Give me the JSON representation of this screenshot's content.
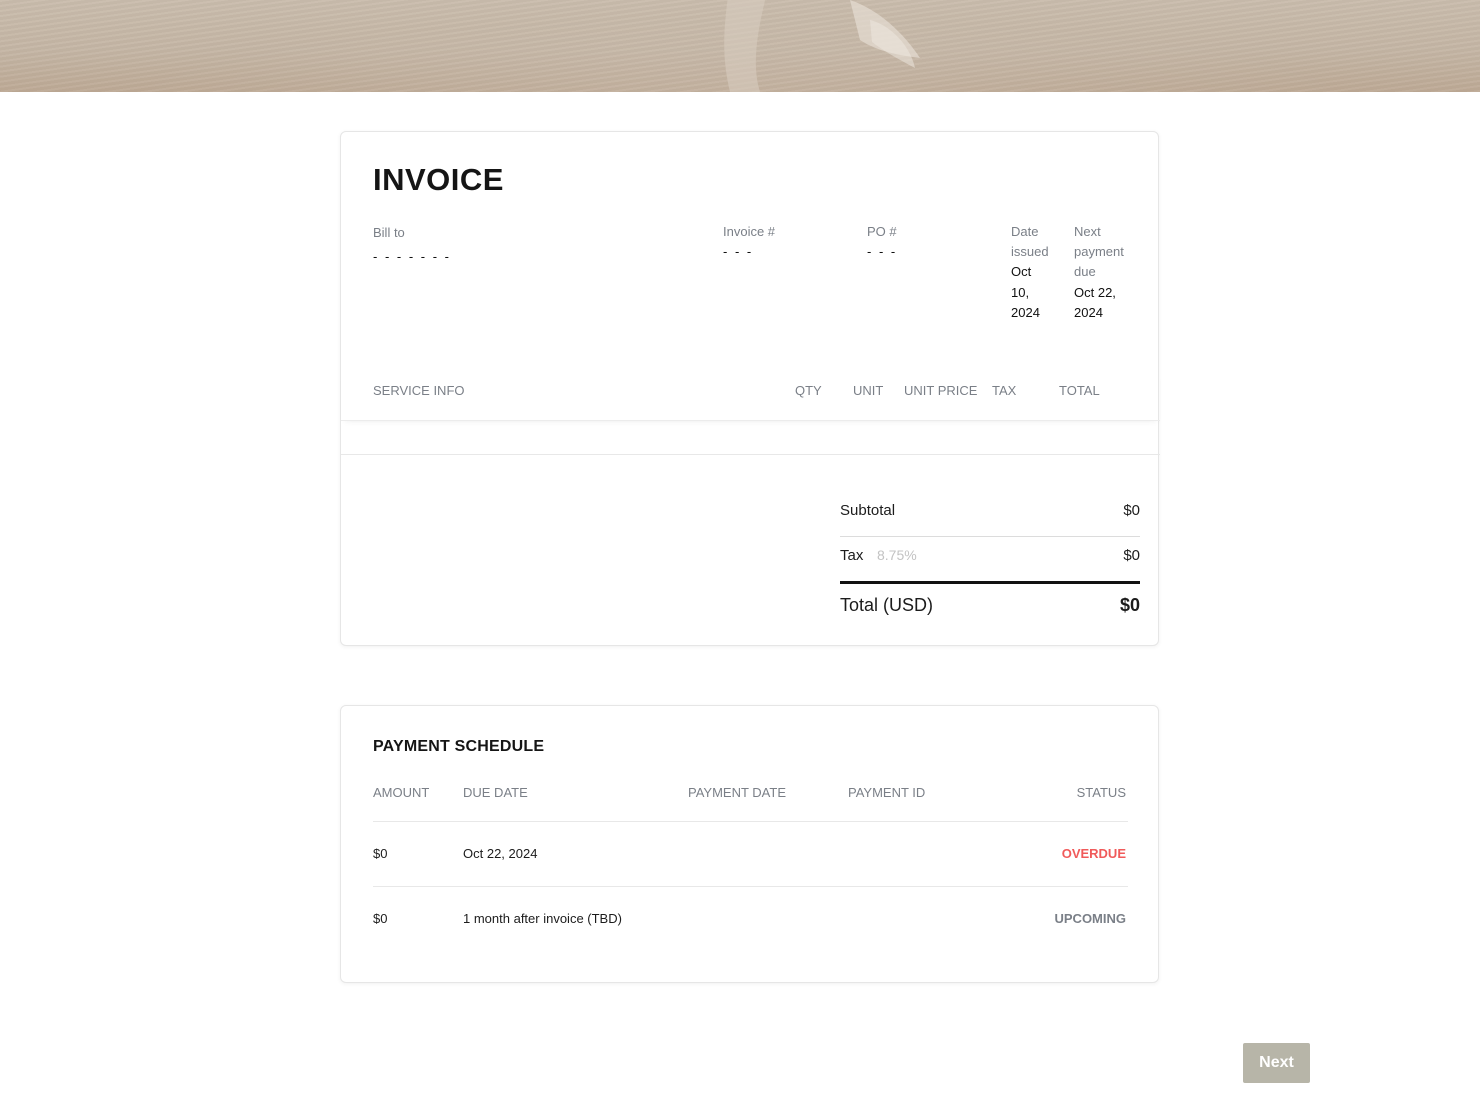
{
  "invoice": {
    "title": "INVOICE",
    "bill_to_label": "Bill to",
    "bill_to_value": "- - - - - - -",
    "invoice_no_label": "Invoice #",
    "invoice_no_value": "- - -",
    "po_label": "PO #",
    "po_value": "- - -",
    "date_issued_label": [
      "Date",
      "issued"
    ],
    "date_issued_value": [
      "Oct",
      "10,",
      "2024"
    ],
    "next_due_label": [
      "Next",
      "payment",
      "due"
    ],
    "next_due_value": [
      "Oct 22,",
      "2024"
    ]
  },
  "services": {
    "columns": [
      "SERVICE INFO",
      "QTY",
      "UNIT",
      "UNIT PRICE",
      "TAX",
      "TOTAL"
    ]
  },
  "totals": {
    "subtotal_label": "Subtotal",
    "subtotal_value": "$0",
    "tax_label": "Tax",
    "tax_rate": "8.75%",
    "tax_value": "$0",
    "total_label": "Total (USD)",
    "total_value": "$0"
  },
  "schedule": {
    "title": "PAYMENT SCHEDULE",
    "columns": [
      "AMOUNT",
      "DUE DATE",
      "PAYMENT DATE",
      "PAYMENT ID",
      "STATUS"
    ],
    "rows": [
      {
        "amount": "$0",
        "due_date": "Oct 22, 2024",
        "payment_date": "",
        "payment_id": "",
        "status": "OVERDUE",
        "status_color": "#f05a5a"
      },
      {
        "amount": "$0",
        "due_date": "1 month after invoice (TBD)",
        "payment_date": "",
        "payment_id": "",
        "status": "UPCOMING",
        "status_color": "#7a7f87"
      }
    ]
  },
  "footer": {
    "next_label": "Next"
  },
  "colors": {
    "accent_button": "#b7b5a8",
    "overdue": "#f05a5a",
    "muted_text": "#7a7f87"
  }
}
